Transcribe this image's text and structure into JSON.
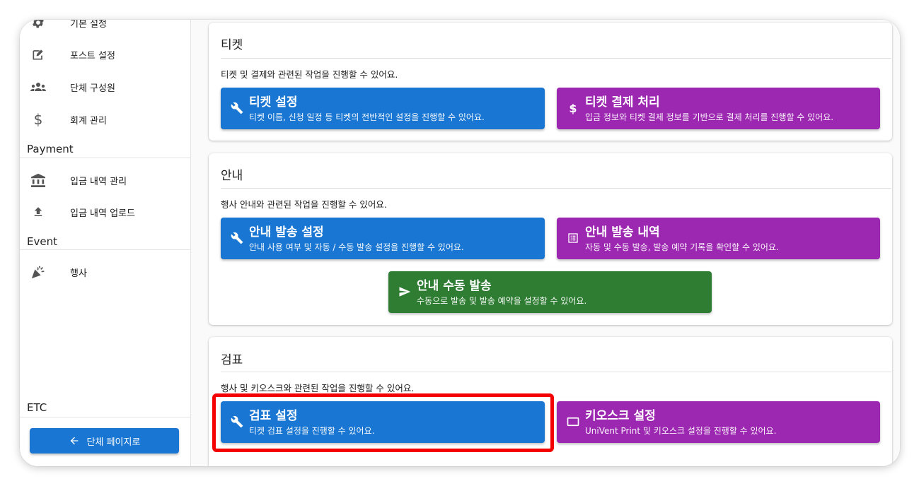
{
  "sidebar": {
    "items_top": [
      {
        "label": "기본 설정",
        "icon": "gear-icon"
      },
      {
        "label": "포스트 설정",
        "icon": "post-edit-icon"
      },
      {
        "label": "단체 구성원",
        "icon": "group-icon"
      },
      {
        "label": "회계 관리",
        "icon": "dollar-icon"
      }
    ],
    "payment_header": "Payment",
    "payment_items": [
      {
        "label": "입금 내역 관리",
        "icon": "bank-icon"
      },
      {
        "label": "입금 내역 업로드",
        "icon": "upload-icon"
      }
    ],
    "event_header": "Event",
    "event_items": [
      {
        "label": "행사",
        "icon": "celebration-icon"
      }
    ],
    "etc_header": "ETC",
    "back_button": "단체 페이지로"
  },
  "cards": {
    "ticket": {
      "title": "티켓",
      "desc": "티켓 및 결제와 관련된 작업을 진행할 수 있어요.",
      "buttons": [
        {
          "title": "티켓 설정",
          "sub": "티켓 이름, 신청 일정 등 티켓의 전반적인 설정을 진행할 수 있어요.",
          "icon": "wrench-icon",
          "color": "#1976d2"
        },
        {
          "title": "티켓 결제 처리",
          "sub": "입금 정보와 티켓 결제 정보를 기반으로 결제 처리를 진행할 수 있어요.",
          "icon": "dollar-icon",
          "color": "#9c27b0"
        }
      ]
    },
    "notice": {
      "title": "안내",
      "desc": "행사 안내와 관련된 작업을 진행할 수 있어요.",
      "buttons": [
        {
          "title": "안내 발송 설정",
          "sub": "안내 사용 여부 및 자동 / 수동 발송 설정을 진행할 수 있어요.",
          "icon": "wrench-icon",
          "color": "#1976d2"
        },
        {
          "title": "안내 발송 내역",
          "sub": "자동 및 수동 발송, 발송 예약 기록을 확인할 수 있어요.",
          "icon": "list-icon",
          "color": "#9c27b0"
        },
        {
          "title": "안내 수동 발송",
          "sub": "수동으로 발송 및 발송 예약을 설정할 수 있어요.",
          "icon": "send-icon",
          "color": "#2e7d32"
        }
      ]
    },
    "checkin": {
      "title": "검표",
      "desc": "행사 및 키오스크와 관련된 작업을 진행할 수 있어요.",
      "buttons": [
        {
          "title": "검표 설정",
          "sub": "티켓 검표 설정을 진행할 수 있어요.",
          "icon": "wrench-icon",
          "color": "#1976d2"
        },
        {
          "title": "키오스크 설정",
          "sub": "UniVent Print 및 키오스크 설정을 진행할 수 있어요.",
          "icon": "kiosk-icon",
          "color": "#9c27b0"
        }
      ]
    }
  },
  "highlight_color": "#f50000"
}
